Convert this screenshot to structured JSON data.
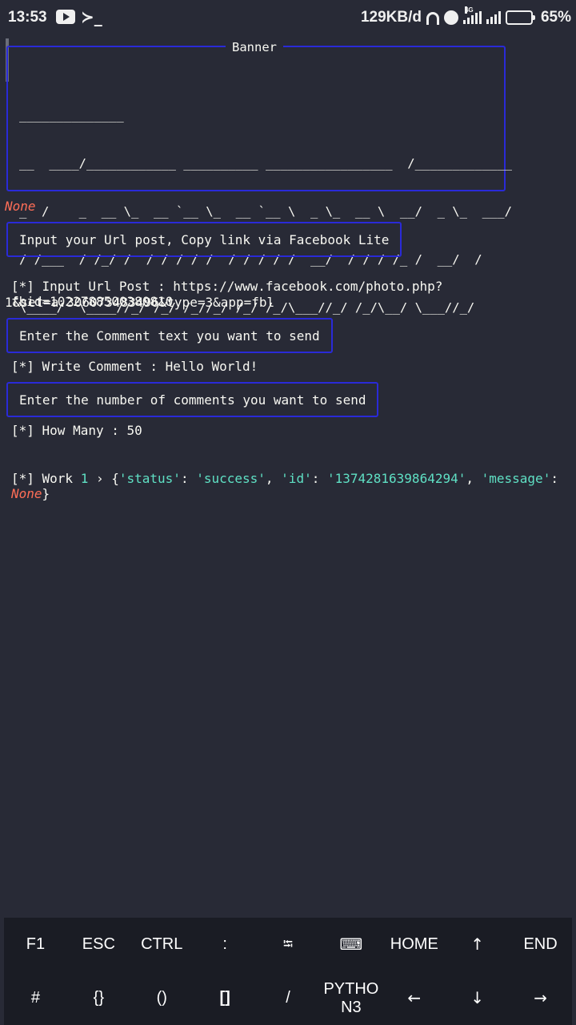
{
  "status_bar": {
    "time": "13:53",
    "terminal_glyph": "≻_",
    "network_speed": "129KB/d",
    "network_type": "4G",
    "battery": "65%"
  },
  "banner": {
    "title": "Banner",
    "ascii_lines": [
      "______________",
      "__  ____/____________ __________ _________________  /_____________",
      "_  /    _  __ \\_  __ `__ \\_  __ `__ \\  _ \\_  __ \\  __/  _ \\_  ___/",
      "/ /___  / /_/ /  / / / / /  / / / / /  __/  / / / /_ /  __/  /",
      "\\____/  \\____//_/ /_/ /_//_/ /_/ /_/\\___//_/ /_/\\__/ \\___//_/"
    ]
  },
  "none_label": "None",
  "prompts": {
    "url": "Input your Url post, Copy link via Facebook Lite",
    "comment": "Enter the Comment text you want to send",
    "count": "Enter the number of comments you want to send"
  },
  "lines": {
    "url_line1": "[*] Input Url Post : https://www.facebook.com/photo.php?fbid=1022788500380810",
    "url_line2": "1&set=a.306073483496&type=3&app=fbl",
    "comment_line": "[*] Write Comment  : Hello World!",
    "howmany_line": "[*] How Many       : 50"
  },
  "work": {
    "prefix": "[*] Work ",
    "num": "1",
    "arrow": " › {",
    "k_status": "'status'",
    "colon1": ": ",
    "v_status": "'success'",
    "sep1": ", ",
    "k_id": "'id'",
    "colon2": ": ",
    "v_id": "'1374281639864294'",
    "sep2": ", ",
    "k_message": "'message'",
    "colon3": ": ",
    "v_message": "None",
    "close": "}"
  },
  "extra_keys": {
    "row1": [
      "F1",
      "ESC",
      "CTRL",
      ":",
      "⭾",
      "⌨",
      "HOME",
      "↑",
      "END"
    ],
    "row2": [
      "#",
      "{}",
      "()",
      "[]",
      "/",
      "PYTHO N3",
      "←",
      "↓",
      "→"
    ]
  },
  "colors": {
    "background": "#282a36",
    "box_border": "#2a2ad8",
    "accent_cyan": "#5fe0c4",
    "accent_red": "#ff6e57",
    "key_bar": "#1a1c24"
  }
}
